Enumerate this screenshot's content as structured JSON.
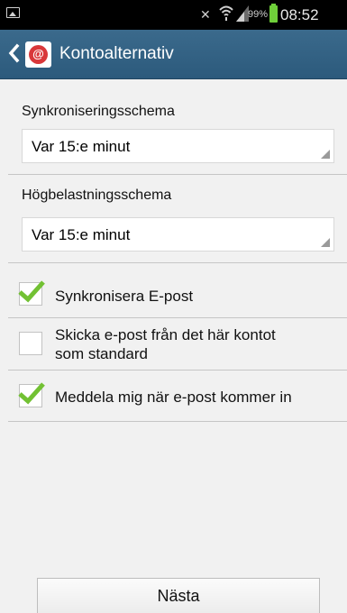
{
  "status_bar": {
    "battery_percent": "99%",
    "time": "08:52",
    "colors": {
      "battery": "#6fcf3a"
    }
  },
  "action_bar": {
    "title": "Kontoalternativ",
    "background": "#2f5d7f"
  },
  "sync_schedule": {
    "label": "Synkroniseringsschema",
    "selected": "Var 15:e minut"
  },
  "peak_schedule": {
    "label": "Högbelastningsschema",
    "selected": "Var 15:e minut"
  },
  "options": [
    {
      "label": "Synkronisera E-post",
      "checked": true
    },
    {
      "label_line1": "Skicka e-post från det här kontot",
      "label_line2": "som standard",
      "checked": false
    },
    {
      "label": "Meddela mig när e-post kommer in",
      "checked": true
    }
  ],
  "next_button": {
    "label": "Nästa"
  },
  "icons": [
    "image-icon",
    "mute-icon",
    "wifi-icon",
    "signal-icon",
    "battery-icon",
    "back-icon",
    "email-app-icon",
    "checkmark-icon",
    "dropdown-corner-icon"
  ],
  "accent_colors": {
    "checkmark": "#72c133"
  }
}
